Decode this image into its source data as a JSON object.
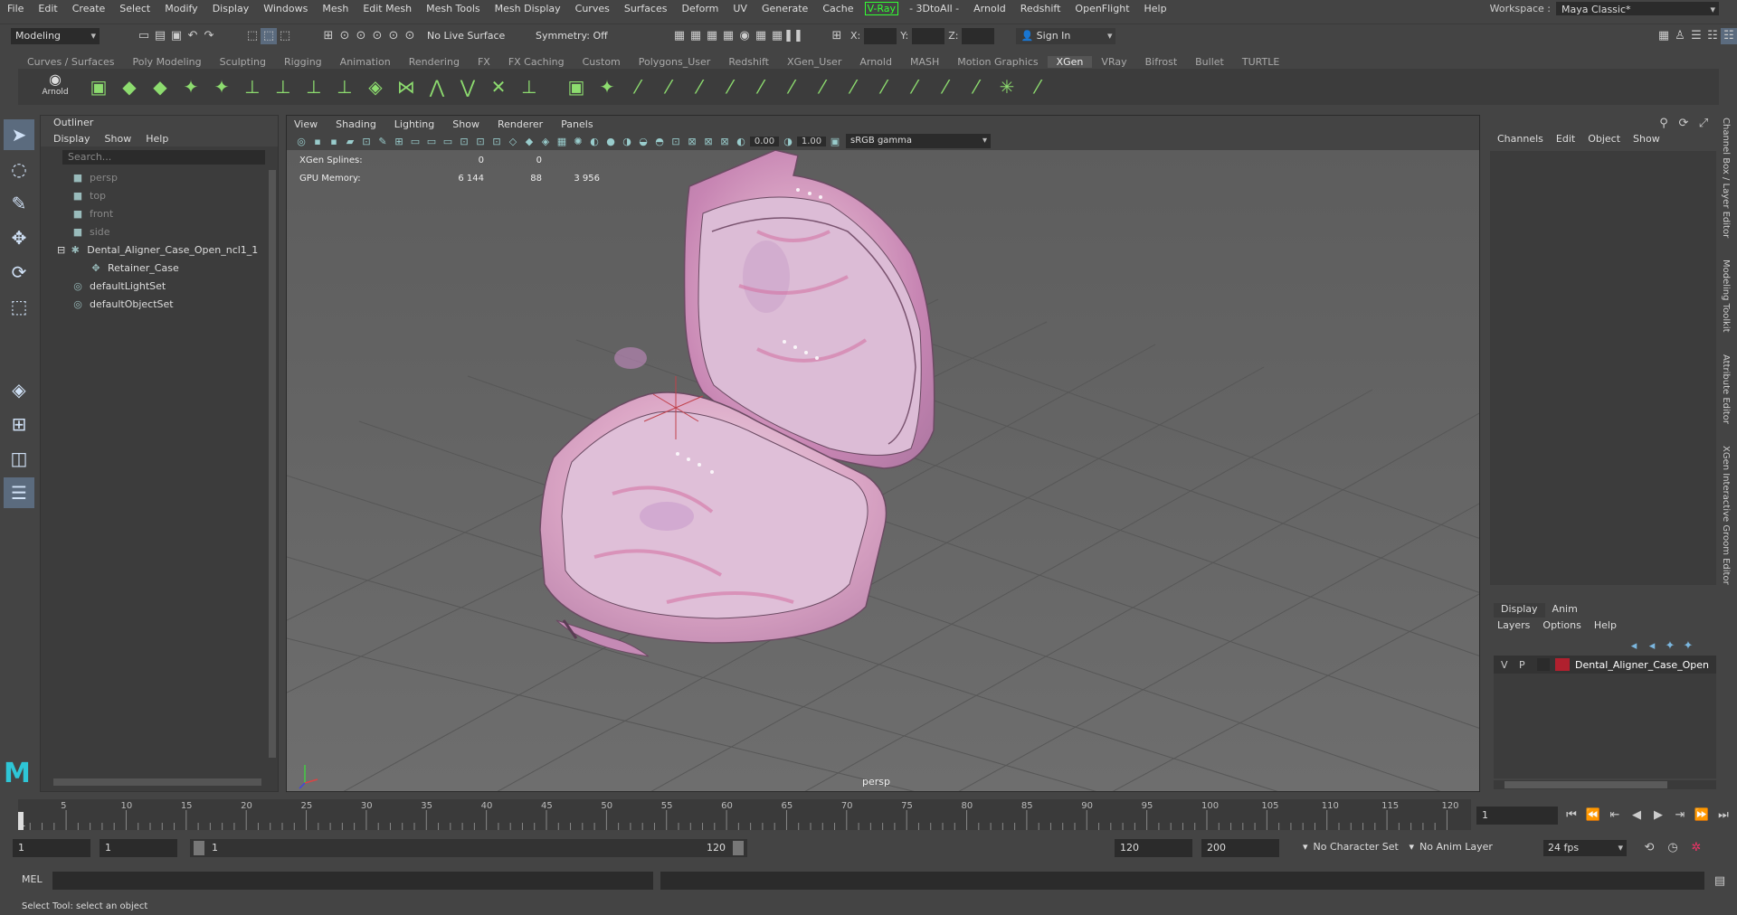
{
  "menubar": {
    "items": [
      "File",
      "Edit",
      "Create",
      "Select",
      "Modify",
      "Display",
      "Windows",
      "Mesh",
      "Edit Mesh",
      "Mesh Tools",
      "Mesh Display",
      "Curves",
      "Surfaces",
      "Deform",
      "UV",
      "Generate",
      "Cache"
    ],
    "vray": "V-Ray",
    "items2": [
      "- 3DtoAll -",
      "Arnold",
      "Redshift",
      "OpenFlight",
      "Help"
    ],
    "workspace_label": "Workspace :",
    "workspace_value": "Maya Classic*"
  },
  "statusline": {
    "mode": "Modeling",
    "live_surface": "No Live Surface",
    "symmetry": "Symmetry: Off",
    "x": "X:",
    "y": "Y:",
    "z": "Z:",
    "sign_in": "Sign In"
  },
  "shelf": {
    "tabs": [
      "Curves / Surfaces",
      "Poly Modeling",
      "Sculpting",
      "Rigging",
      "Animation",
      "Rendering",
      "FX",
      "FX Caching",
      "Custom",
      "Polygons_User",
      "Redshift",
      "XGen_User",
      "Arnold",
      "MASH",
      "Motion Graphics",
      "XGen",
      "VRay",
      "Bifrost",
      "Bullet",
      "TURTLE"
    ],
    "active": "XGen",
    "arnold_label": "Arnold"
  },
  "outliner": {
    "title": "Outliner",
    "menu": [
      "Display",
      "Show",
      "Help"
    ],
    "search_placeholder": "Search...",
    "items": [
      {
        "label": "persp",
        "type": "camera",
        "dim": true,
        "indent": 0
      },
      {
        "label": "top",
        "type": "camera",
        "dim": true,
        "indent": 0
      },
      {
        "label": "front",
        "type": "camera",
        "dim": true,
        "indent": 0
      },
      {
        "label": "side",
        "type": "camera",
        "dim": true,
        "indent": 0
      },
      {
        "label": "Dental_Aligner_Case_Open_ncl1_1",
        "type": "group",
        "dim": false,
        "indent": 0
      },
      {
        "label": "Retainer_Case",
        "type": "mesh",
        "dim": false,
        "indent": 1
      },
      {
        "label": "defaultLightSet",
        "type": "set",
        "dim": false,
        "indent": 0
      },
      {
        "label": "defaultObjectSet",
        "type": "set",
        "dim": false,
        "indent": 0
      }
    ]
  },
  "viewport": {
    "menu": [
      "View",
      "Shading",
      "Lighting",
      "Show",
      "Renderer",
      "Panels"
    ],
    "exposure": "0.00",
    "gamma": "1.00",
    "colorspace": "sRGB gamma",
    "hud": [
      {
        "k": "XGen Splines:",
        "v1": "0",
        "v2": "0",
        "v3": ""
      },
      {
        "k": "GPU Memory:",
        "v1": "6 144",
        "v2": "88",
        "v3": "3 956"
      }
    ],
    "camera_label": "persp"
  },
  "channelbox": {
    "menu": [
      "Channels",
      "Edit",
      "Object",
      "Show"
    ]
  },
  "layers": {
    "tabs": [
      "Display",
      "Anim"
    ],
    "menu": [
      "Layers",
      "Options",
      "Help"
    ],
    "row": {
      "v": "V",
      "p": "P",
      "name": "Dental_Aligner_Case_Open",
      "color": "#b0202e"
    }
  },
  "sidetabs": [
    "Channel Box / Layer Editor",
    "Modeling Toolkit",
    "Attribute Editor",
    "XGen Interactive Groom Editor"
  ],
  "timeline": {
    "ticks": [
      "5",
      "10",
      "15",
      "20",
      "25",
      "30",
      "35",
      "40",
      "45",
      "50",
      "55",
      "60",
      "65",
      "70",
      "75",
      "80",
      "85",
      "90",
      "95",
      "100",
      "105",
      "110",
      "115",
      "120"
    ],
    "current_start": "1",
    "current_frame": "1"
  },
  "range": {
    "start": "1",
    "start2": "1",
    "slider_start": "1",
    "slider_end": "120",
    "end": "120",
    "end2": "200",
    "char_set": "No Character Set",
    "anim_layer": "No Anim Layer",
    "fps": "24 fps"
  },
  "cmdline": {
    "label": "MEL"
  },
  "helpline": "Select Tool: select an object"
}
